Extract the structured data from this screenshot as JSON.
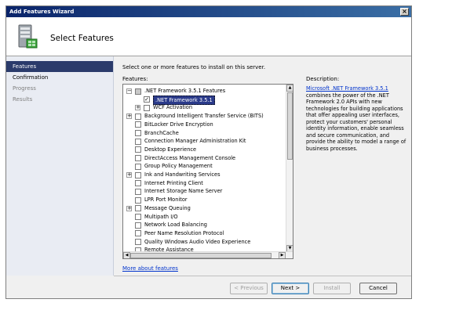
{
  "window": {
    "title": "Add Features Wizard",
    "close_glyph": "×"
  },
  "header": {
    "title": "Select Features",
    "icon": "server-features-icon"
  },
  "nav": {
    "items": [
      {
        "label": "Features",
        "state": "active"
      },
      {
        "label": "Confirmation",
        "state": "normal"
      },
      {
        "label": "Progress",
        "state": "disabled"
      },
      {
        "label": "Results",
        "state": "disabled"
      }
    ]
  },
  "main": {
    "instruction": "Select one or more features to install on this server.",
    "features_label": "Features:",
    "description_label": "Description:",
    "description_link": "Microsoft .NET Framework 3.5.1",
    "description_text": "combines the power of the .NET Framework 2.0 APIs with new technologies for building applications that offer appealing user interfaces, protect your customers' personal identity information, enable seamless and secure communication, and provide the ability to model a range of business processes.",
    "more_link": "More about features"
  },
  "features": [
    {
      "label": ".NET Framework 3.5.1 Features",
      "level": 0,
      "expander": "−",
      "checked": "partial"
    },
    {
      "label": ".NET Framework 3.5.1",
      "level": 1,
      "expander": "",
      "checked": "checked",
      "selected": true
    },
    {
      "label": "WCF Activation",
      "level": 1,
      "expander": "+",
      "checked": "unchecked"
    },
    {
      "label": "Background Intelligent Transfer Service (BITS)",
      "level": 0,
      "expander": "+",
      "checked": "unchecked"
    },
    {
      "label": "BitLocker Drive Encryption",
      "level": 0,
      "expander": "",
      "checked": "unchecked"
    },
    {
      "label": "BranchCache",
      "level": 0,
      "expander": "",
      "checked": "unchecked"
    },
    {
      "label": "Connection Manager Administration Kit",
      "level": 0,
      "expander": "",
      "checked": "unchecked"
    },
    {
      "label": "Desktop Experience",
      "level": 0,
      "expander": "",
      "checked": "unchecked"
    },
    {
      "label": "DirectAccess Management Console",
      "level": 0,
      "expander": "",
      "checked": "unchecked"
    },
    {
      "label": "Group Policy Management",
      "level": 0,
      "expander": "",
      "checked": "unchecked"
    },
    {
      "label": "Ink and Handwriting Services",
      "level": 0,
      "expander": "+",
      "checked": "unchecked"
    },
    {
      "label": "Internet Printing Client",
      "level": 0,
      "expander": "",
      "checked": "unchecked"
    },
    {
      "label": "Internet Storage Name Server",
      "level": 0,
      "expander": "",
      "checked": "unchecked"
    },
    {
      "label": "LPR Port Monitor",
      "level": 0,
      "expander": "",
      "checked": "unchecked"
    },
    {
      "label": "Message Queuing",
      "level": 0,
      "expander": "+",
      "checked": "unchecked"
    },
    {
      "label": "Multipath I/O",
      "level": 0,
      "expander": "",
      "checked": "unchecked"
    },
    {
      "label": "Network Load Balancing",
      "level": 0,
      "expander": "",
      "checked": "unchecked"
    },
    {
      "label": "Peer Name Resolution Protocol",
      "level": 0,
      "expander": "",
      "checked": "unchecked"
    },
    {
      "label": "Quality Windows Audio Video Experience",
      "level": 0,
      "expander": "",
      "checked": "unchecked"
    },
    {
      "label": "Remote Assistance",
      "level": 0,
      "expander": "",
      "checked": "unchecked"
    }
  ],
  "buttons": {
    "previous": "< Previous",
    "next": "Next >",
    "install": "Install",
    "cancel": "Cancel"
  },
  "glyphs": {
    "check": "✓",
    "up": "▲",
    "down": "▼",
    "left": "◀",
    "right": "▶"
  },
  "colors": {
    "selected_nav": "#2b3b6b",
    "link": "#0033cc",
    "title_bar": "#0a246a"
  }
}
